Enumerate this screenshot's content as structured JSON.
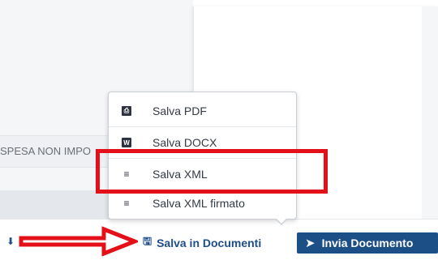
{
  "form": {
    "spesa_field_text": "SPESA NON IMPO"
  },
  "menu": {
    "items": [
      {
        "label": "Salva PDF",
        "icon": "pdf-icon",
        "icon_text": ""
      },
      {
        "label": "Salva DOCX",
        "icon": "word-icon",
        "icon_text": "W"
      },
      {
        "label": "Salva XML",
        "icon": "lines-icon",
        "icon_text": "≡"
      },
      {
        "label": "Salva XML firmato",
        "icon": "lines-icon",
        "icon_text": "≡"
      }
    ]
  },
  "toolbar": {
    "save_docs_label": "Salva in Documenti",
    "save_docs_icon": "floppy-disk-icon",
    "send_label": "Invia Documento",
    "send_icon": "send-arrow-icon",
    "download_icon": "download-icon"
  },
  "annotations": {
    "highlight_color": "#e3101a",
    "arrow_color": "#e3101a"
  }
}
